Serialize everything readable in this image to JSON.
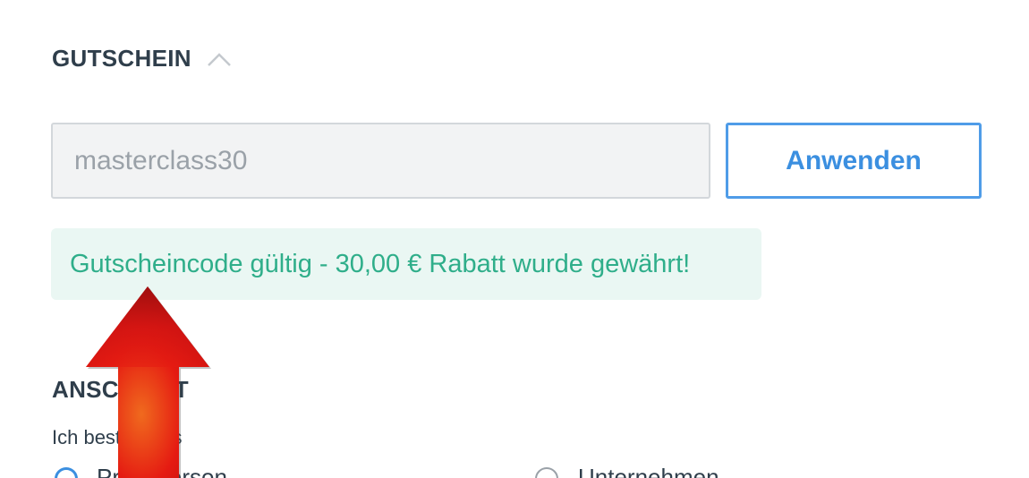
{
  "coupon": {
    "title": "GUTSCHEIN",
    "collapse_icon": "chevron-up-icon",
    "input_value": "masterclass30",
    "apply_label": "Anwenden",
    "success_message": "Gutscheincode gültig - 30,00 € Rabatt wurde gewährt!"
  },
  "address": {
    "title": "ANSCHRIFT",
    "subtitle": "Ich bestelle als",
    "options": [
      "Privatperson",
      "Unternehmen"
    ],
    "selected": "Privatperson"
  },
  "annotation": {
    "icon": "red-arrow-up-icon"
  },
  "colors": {
    "heading": "#2f3e4b",
    "accent_blue": "#4f9ce8",
    "success_green": "#2fae8a",
    "success_bg": "#eaf7f3",
    "input_bg": "#f2f3f4",
    "arrow_red": "#e01010"
  }
}
